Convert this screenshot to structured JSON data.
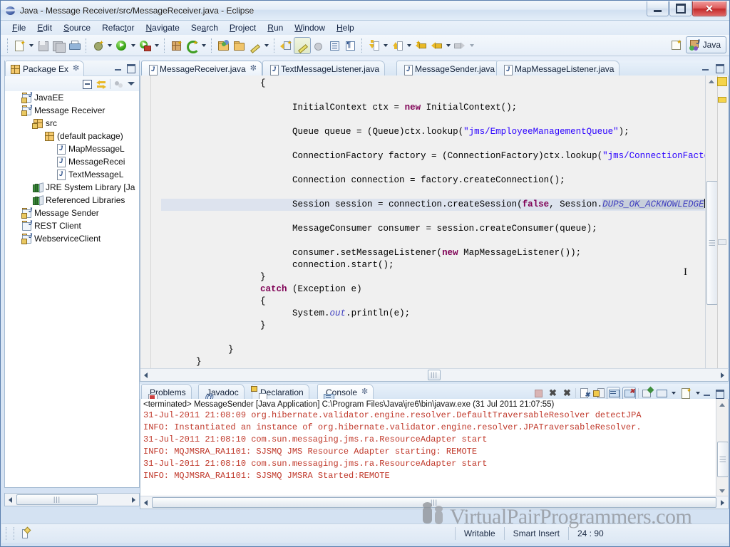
{
  "window": {
    "title": "Java - Message Receiver/src/MessageReceiver.java - Eclipse",
    "app_icon": "eclipse-icon",
    "minimize_label": "–",
    "maximize_label": "□",
    "close_label": "✕"
  },
  "menu": [
    {
      "label": "File",
      "accel": "F"
    },
    {
      "label": "Edit",
      "accel": "E"
    },
    {
      "label": "Source",
      "accel": "S"
    },
    {
      "label": "Refactor",
      "accel": "t"
    },
    {
      "label": "Navigate",
      "accel": "N"
    },
    {
      "label": "Search",
      "accel": "a"
    },
    {
      "label": "Project",
      "accel": "P"
    },
    {
      "label": "Run",
      "accel": "R"
    },
    {
      "label": "Window",
      "accel": "W"
    },
    {
      "label": "Help",
      "accel": "H"
    }
  ],
  "toolbar": {
    "items": [
      {
        "name": "new-wizard-icon",
        "tooltip": "New",
        "dropdown": true
      },
      {
        "name": "save-icon",
        "tooltip": "Save",
        "dropdown": false
      },
      {
        "name": "save-all-icon",
        "tooltip": "Save All",
        "dropdown": false
      },
      {
        "name": "print-icon",
        "tooltip": "Print",
        "dropdown": false
      },
      {
        "name": "debug-icon",
        "tooltip": "Debug",
        "dropdown": true
      },
      {
        "name": "run-icon",
        "tooltip": "Run",
        "dropdown": true
      },
      {
        "name": "external-tools-icon",
        "tooltip": "External Tools",
        "dropdown": true
      },
      {
        "name": "new-java-package-icon",
        "tooltip": "New Java Package",
        "dropdown": false
      },
      {
        "name": "new-java-class-icon",
        "tooltip": "New Java Class",
        "dropdown": true
      },
      {
        "name": "open-type-icon",
        "tooltip": "Open Type",
        "dropdown": false
      },
      {
        "name": "open-task-icon",
        "tooltip": "Open Task",
        "dropdown": false
      },
      {
        "name": "pencil-icon",
        "tooltip": "Edit",
        "dropdown": true
      },
      {
        "name": "search-reference-icon",
        "tooltip": "Search",
        "dropdown": false
      },
      {
        "name": "toggle-mark-occurrences-icon",
        "tooltip": "Toggle Mark Occurrences",
        "dropdown": false,
        "pressed": true
      },
      {
        "name": "skip-breakpoints-icon",
        "tooltip": "Skip All Breakpoints",
        "dropdown": false
      },
      {
        "name": "show-whitespace-icon",
        "tooltip": "Show Whitespace Characters",
        "dropdown": false
      },
      {
        "name": "block-selection-icon",
        "tooltip": "Toggle Block Selection",
        "dropdown": false
      },
      {
        "name": "next-annotation-icon",
        "tooltip": "Next Annotation",
        "dropdown": true
      },
      {
        "name": "previous-annotation-icon",
        "tooltip": "Previous Annotation",
        "dropdown": true
      },
      {
        "name": "last-edit-location-icon",
        "tooltip": "Last Edit Location",
        "dropdown": false
      },
      {
        "name": "back-icon",
        "tooltip": "Back",
        "dropdown": true
      },
      {
        "name": "forward-icon",
        "tooltip": "Forward",
        "dropdown": true
      }
    ],
    "open_perspective_icon": "open-perspective-icon",
    "perspective": {
      "label": "Java",
      "icon": "java-perspective-icon"
    }
  },
  "package_explorer": {
    "tab_label": "Package Ex",
    "tab_icon": "package-explorer-icon",
    "close_icon": "close-icon",
    "minimize_icon": "minimize-icon",
    "maximize_icon": "maximize-icon",
    "toolbar": [
      {
        "name": "collapse-all-icon",
        "label": "Collapse All"
      },
      {
        "name": "link-with-editor-icon",
        "label": "Link with Editor"
      },
      {
        "name": "view-menu-dots-icon",
        "label": "View Menu"
      },
      {
        "name": "view-menu-caret-icon",
        "label": "View Menu"
      }
    ],
    "tree": [
      {
        "label": "JavaEE",
        "icon": "java-project-icon",
        "indent": 0
      },
      {
        "label": "Message Receiver",
        "icon": "java-project-icon",
        "indent": 0
      },
      {
        "label": "src",
        "icon": "source-folder-icon",
        "indent": 1
      },
      {
        "label": "(default package)",
        "icon": "package-icon",
        "indent": 2
      },
      {
        "label": "MapMessageL",
        "icon": "java-file-icon",
        "indent": 3
      },
      {
        "label": "MessageRecei",
        "icon": "java-file-icon",
        "indent": 3
      },
      {
        "label": "TextMessageL",
        "icon": "java-file-icon",
        "indent": 3
      },
      {
        "label": "JRE System Library [Ja",
        "icon": "library-icon",
        "indent": 1
      },
      {
        "label": "Referenced Libraries",
        "icon": "library-icon",
        "indent": 1
      },
      {
        "label": "Message Sender",
        "icon": "java-project-icon",
        "indent": 0
      },
      {
        "label": "REST Client",
        "icon": "project-icon",
        "indent": 0
      },
      {
        "label": "WebserviceClient",
        "icon": "java-project-icon",
        "indent": 0
      }
    ]
  },
  "editor": {
    "tabs": [
      {
        "label": "MessageReceiver.java",
        "icon": "java-file-icon",
        "active": true,
        "closeable": true
      },
      {
        "label": "TextMessageListener.java",
        "icon": "java-file-icon",
        "active": false,
        "closeable": false
      },
      {
        "label": "MessageSender.java",
        "icon": "java-file-icon",
        "active": false,
        "closeable": false
      },
      {
        "label": "MapMessageListener.java",
        "icon": "java-file-icon",
        "active": false,
        "closeable": false
      }
    ],
    "minimize_icon": "minimize-icon",
    "maximize_icon": "maximize-icon",
    "code_lines": [
      {
        "indent": 6,
        "segments": [
          {
            "t": "{",
            "c": ""
          }
        ]
      },
      {
        "indent": 0,
        "segments": []
      },
      {
        "indent": 8,
        "segments": [
          {
            "t": "InitialContext ctx = ",
            "c": ""
          },
          {
            "t": "new",
            "c": "kw"
          },
          {
            "t": " InitialContext();",
            "c": ""
          }
        ]
      },
      {
        "indent": 0,
        "segments": []
      },
      {
        "indent": 8,
        "segments": [
          {
            "t": "Queue queue = (Queue)ctx.lookup(",
            "c": ""
          },
          {
            "t": "\"jms/EmployeeManagementQueue\"",
            "c": "str"
          },
          {
            "t": ");",
            "c": ""
          }
        ]
      },
      {
        "indent": 0,
        "segments": []
      },
      {
        "indent": 8,
        "segments": [
          {
            "t": "ConnectionFactory factory = (ConnectionFactory)ctx.lookup(",
            "c": ""
          },
          {
            "t": "\"jms/ConnectionFactory\"",
            "c": "str"
          },
          {
            "t": ")",
            "c": ""
          }
        ]
      },
      {
        "indent": 0,
        "segments": []
      },
      {
        "indent": 8,
        "segments": [
          {
            "t": "Connection connection = factory.createConnection();",
            "c": ""
          }
        ]
      },
      {
        "indent": 0,
        "segments": []
      },
      {
        "indent": 8,
        "highlight": true,
        "segments": [
          {
            "t": "Session session = connection.createSession(",
            "c": ""
          },
          {
            "t": "false",
            "c": "kw"
          },
          {
            "t": ", Session.",
            "c": ""
          },
          {
            "t": "DUPS_OK_ACKNOWLEDGE",
            "c": "stat sel"
          },
          {
            "t": "│",
            "c": "caretchar"
          },
          {
            "t": ");",
            "c": ""
          }
        ]
      },
      {
        "indent": 0,
        "segments": []
      },
      {
        "indent": 8,
        "segments": [
          {
            "t": "MessageConsumer consumer = session.createConsumer(queue);",
            "c": ""
          }
        ]
      },
      {
        "indent": 0,
        "segments": []
      },
      {
        "indent": 8,
        "segments": [
          {
            "t": "consumer.setMessageListener(",
            "c": ""
          },
          {
            "t": "new",
            "c": "kw"
          },
          {
            "t": " MapMessageListener());",
            "c": ""
          }
        ]
      },
      {
        "indent": 8,
        "segments": [
          {
            "t": "connection.start();",
            "c": ""
          }
        ]
      },
      {
        "indent": 6,
        "segments": [
          {
            "t": "}",
            "c": ""
          }
        ]
      },
      {
        "indent": 6,
        "segments": [
          {
            "t": "catch",
            "c": "kw"
          },
          {
            "t": " (Exception e)",
            "c": ""
          }
        ]
      },
      {
        "indent": 6,
        "segments": [
          {
            "t": "{",
            "c": ""
          }
        ]
      },
      {
        "indent": 8,
        "segments": [
          {
            "t": "System.",
            "c": ""
          },
          {
            "t": "out",
            "c": "stat"
          },
          {
            "t": ".println(e);",
            "c": ""
          }
        ]
      },
      {
        "indent": 6,
        "segments": [
          {
            "t": "}",
            "c": ""
          }
        ]
      },
      {
        "indent": 0,
        "segments": []
      },
      {
        "indent": 4,
        "segments": [
          {
            "t": "}",
            "c": ""
          }
        ]
      },
      {
        "indent": 2,
        "segments": [
          {
            "t": "}",
            "c": ""
          }
        ]
      }
    ]
  },
  "console": {
    "tabs": [
      {
        "label": "Problems",
        "icon": "problems-icon",
        "active": false
      },
      {
        "label": "Javadoc",
        "icon": "javadoc-at-icon",
        "active": false
      },
      {
        "label": "Declaration",
        "icon": "declaration-icon",
        "active": false
      },
      {
        "label": "Console",
        "icon": "console-icon",
        "active": true,
        "closeable": true
      }
    ],
    "toolbar": [
      {
        "name": "terminate-icon",
        "label": "Terminate",
        "disabled": true
      },
      {
        "name": "remove-launch-icon",
        "label": "Remove Launch"
      },
      {
        "name": "remove-all-terminated-icon",
        "label": "Remove All Terminated Launches"
      },
      {
        "name": "clear-console-icon",
        "label": "Clear Console"
      },
      {
        "name": "scroll-lock-icon",
        "label": "Scroll Lock"
      },
      {
        "name": "show-console-on-output-icon",
        "label": "Show Console When Standard Out Changes",
        "pressed": true
      },
      {
        "name": "show-console-on-error-icon",
        "label": "Show Console When Standard Error Changes",
        "pressed": true
      },
      {
        "name": "pin-console-icon",
        "label": "Pin Console"
      },
      {
        "name": "display-selected-console-icon",
        "label": "Display Selected Console",
        "dropdown": true
      },
      {
        "name": "open-console-icon",
        "label": "Open Console",
        "dropdown": true
      },
      {
        "name": "minimize-icon",
        "label": "Minimize"
      },
      {
        "name": "maximize-icon",
        "label": "Maximize"
      }
    ],
    "header": "<terminated> MessageSender [Java Application] C:\\Program Files\\Java\\jre6\\bin\\javaw.exe (31 Jul 2011 21:07:55)",
    "lines": [
      "31-Jul-2011 21:08:09 org.hibernate.validator.engine.resolver.DefaultTraversableResolver detectJPA",
      "INFO: Instantiated an instance of org.hibernate.validator.engine.resolver.JPATraversableResolver.",
      "31-Jul-2011 21:08:10 com.sun.messaging.jms.ra.ResourceAdapter start",
      "INFO: MQJMSRA_RA1101: SJSMQ JMS Resource Adapter starting: REMOTE",
      "31-Jul-2011 21:08:10 com.sun.messaging.jms.ra.ResourceAdapter start",
      "INFO: MQJMSRA_RA1101: SJSMQ JMSRA Started:REMOTE"
    ],
    "text_color": "#c0392b"
  },
  "statusbar": {
    "icon": "editor-status-icon",
    "writable": "Writable",
    "insert_mode": "Smart Insert",
    "position": "24 : 90"
  },
  "watermark": {
    "text": "VirtualPairProgrammers.com",
    "logo": "two-people-logo"
  },
  "colors": {
    "keyword": "#7f0055",
    "string": "#2a00ff",
    "static_field": "#3f3fbf",
    "console_error": "#c0392b",
    "selection": "#c8cfdb",
    "current_line": "#dde3ee",
    "chrome": "#d3e1f2"
  }
}
